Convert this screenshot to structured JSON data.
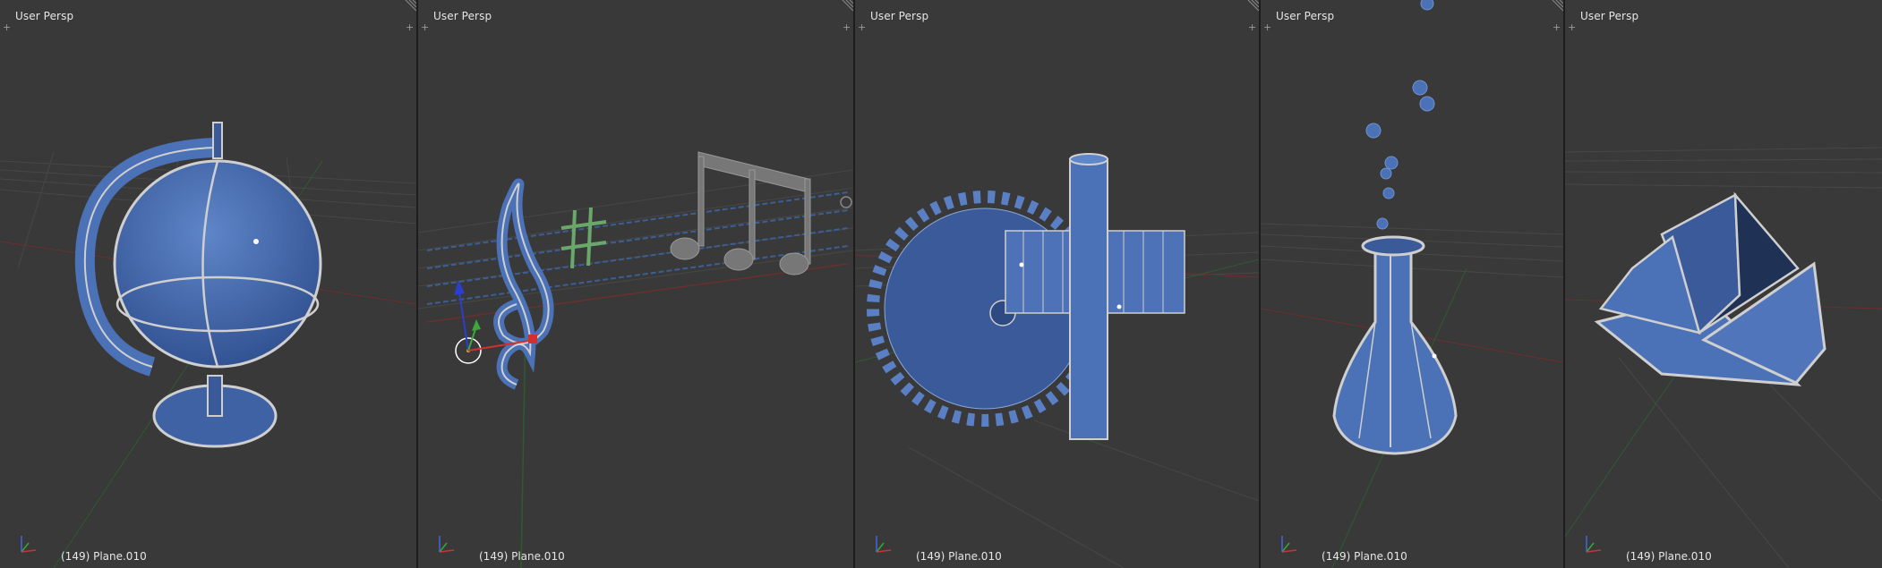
{
  "viewports": [
    {
      "title": "User Persp",
      "status": "(149) Plane.010",
      "object": "globe"
    },
    {
      "title": "User Persp",
      "status": "(149) Plane.010",
      "object": "treble-clef"
    },
    {
      "title": "User Persp",
      "status": "(149) Plane.010",
      "object": "gear-shaft"
    },
    {
      "title": "User Persp",
      "status": "(149) Plane.010",
      "object": "flask"
    },
    {
      "title": "User Persp",
      "status": "(149) Plane.010",
      "object": "open-book"
    }
  ],
  "icons": {
    "viewport_add": "plus-icon",
    "viewport_split": "corner-hatch-icon",
    "axis_gizmo": "axes-icon"
  },
  "colors": {
    "background": "#393939",
    "mesh_blue": "#4466aa",
    "wire": "#c8c8c8",
    "grid": "#4a4a4a",
    "x_axis": "#8a3030",
    "y_axis": "#3d7a3d"
  }
}
